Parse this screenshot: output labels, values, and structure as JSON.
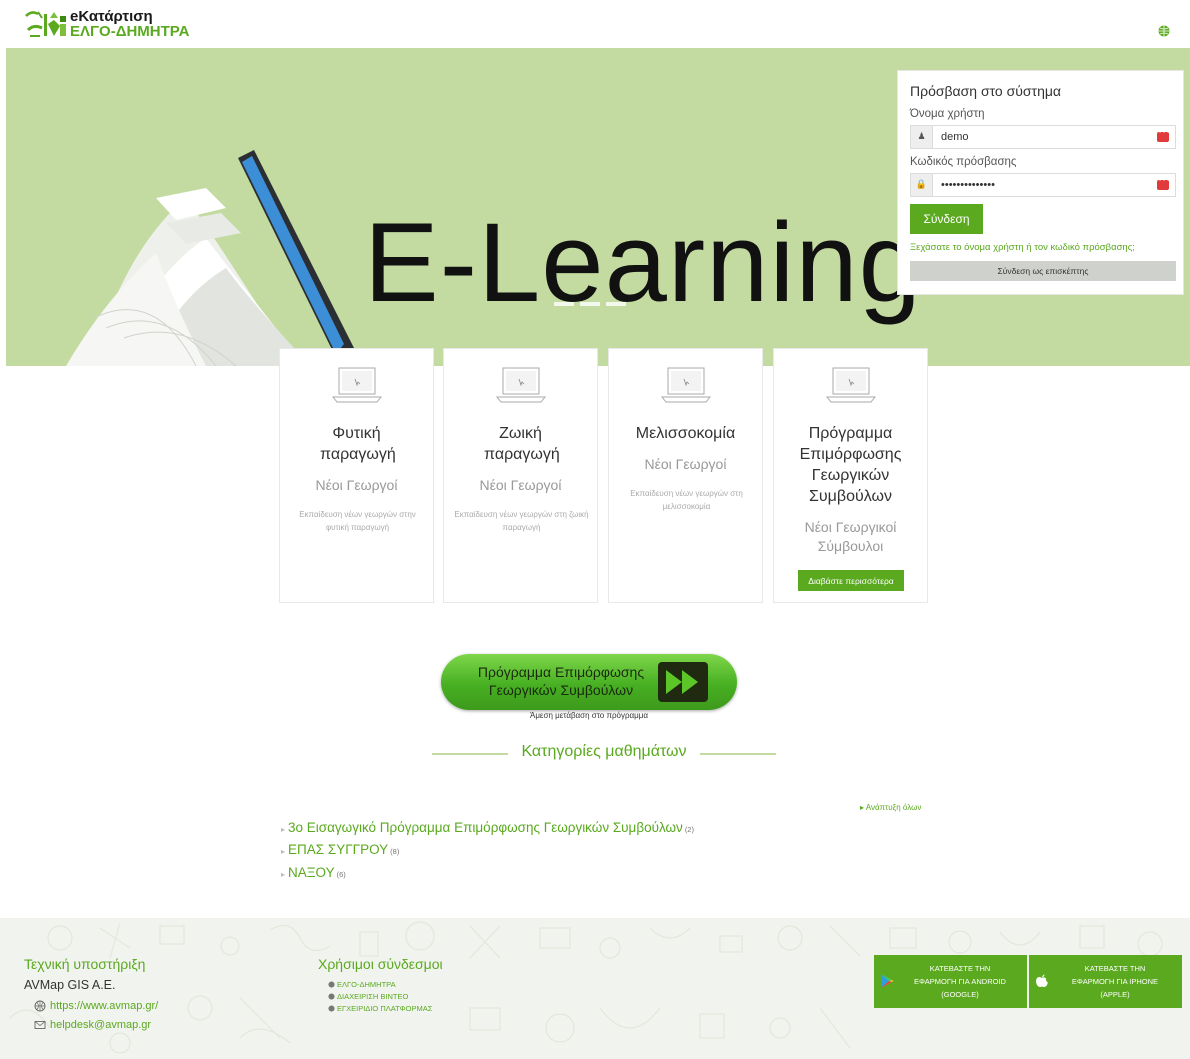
{
  "header": {
    "logo_line1": "eΚατάρτιση",
    "logo_line2": "ΕΛΓΟ-ΔΗΜΗΤΡΑ",
    "language_icon": "globe-icon"
  },
  "hero": {
    "title": "E-Learning",
    "slide_count": 3
  },
  "login": {
    "title": "Πρόσβαση στο σύστημα",
    "username_label": "Όνομα χρήστη",
    "username_value": "demo",
    "password_label": "Κωδικός πρόσβασης",
    "password_value": "••••••••••••••",
    "submit_label": "Σύνδεση",
    "forgot_link": "Ξεχάσατε το όνομα χρήστη ή τον κωδικό πρόσβασης;",
    "guest_label": "Σύνδεση ως επισκέπτης"
  },
  "cards": [
    {
      "title": "Φυτική παραγωγή",
      "subtitle": "Νέοι Γεωργοί",
      "description": "Εκπαίδευση νέων γεωργών στην φυτική παραγωγή"
    },
    {
      "title": "Ζωική παραγωγή",
      "subtitle": "Νέοι Γεωργοί",
      "description": "Εκπαίδευση νέων γεωργών στη ζωική παραγωγή"
    },
    {
      "title": "Μελισσοκομία",
      "subtitle": "Νέοι Γεωργοί",
      "description": "Εκπαίδευση νέων γεωργών στη μελισσοκομία"
    },
    {
      "title": "Πρόγραμμα Επιμόρφωσης Γεωργικών Συμβούλων",
      "subtitle": "Νέοι Γεωργικοί Σύμβουλοι",
      "button": "Διαβάστε περισσότερα"
    }
  ],
  "program_banner": {
    "line1": "Πρόγραμμα Επιμόρφωσης",
    "line2": "Γεωργικών Συμβούλων",
    "caption": "Άμεση μετάβαση στο πρόγραμμα"
  },
  "categories": {
    "heading": "Κατηγορίες μαθημάτων",
    "expand_all": "Ανάπτυξη όλων",
    "items": [
      {
        "label": "3ο Εισαγωγικό Πρόγραμμα Επιμόρφωσης Γεωργικών Συμβούλων",
        "count": "(2)"
      },
      {
        "label": "ΕΠΑΣ ΣΥΓΓΡΟΥ",
        "count": "(8)"
      },
      {
        "label": "ΝΑΞΟΥ",
        "count": "(6)"
      }
    ]
  },
  "footer": {
    "support_title": "Τεχνική υποστήριξη",
    "support_company": "AVMap GIS A.E.",
    "support_website": "https://www.avmap.gr/",
    "support_email": "helpdesk@avmap.gr",
    "links_title": "Χρήσιμοι σύνδεσμοι",
    "links": [
      "ΕΛΓΟ-ΔΗΜΗΤΡΑ",
      "ΔΙΑΧΕΙΡΙΣΗ ΒΙΝΤΕΟ",
      "ΕΓΧΕΙΡΙΔΙΟ ΠΛΑΤΦΟΡΜΑΣ"
    ],
    "android_line1": "ΚΑΤΕΒΑΣΤΕ ΤΗΝ",
    "android_line2": "ΕΦΑΡΜΟΓΗ ΓΙΑ ANDROID",
    "android_line3": "(GOOGLE)",
    "iphone_line1": "ΚΑΤΕΒΑΣΤΕ ΤΗΝ",
    "iphone_line2": "ΕΦΑΡΜΟΓΗ ΓΙΑ IPHONE",
    "iphone_line3": "(APPLE)"
  },
  "colors": {
    "accent": "#5aa91e",
    "hero_bg": "#c3dba0",
    "footer_bg": "#f1f4ee",
    "badge_red": "#e03a3a"
  }
}
